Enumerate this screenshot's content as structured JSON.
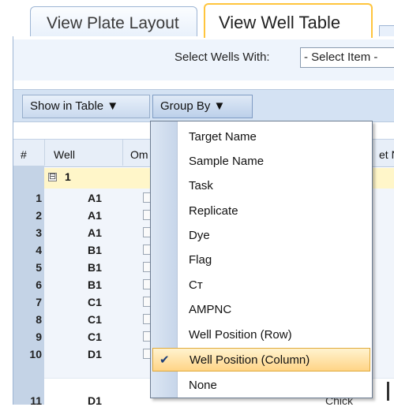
{
  "tabs": [
    {
      "label": "View Plate Layout",
      "active": false
    },
    {
      "label": "View Well Table",
      "active": true
    }
  ],
  "filter": {
    "label": "Select Wells With:",
    "select_value": "- Select Item -"
  },
  "toolbar": {
    "show_in_table": "Show in Table ▼",
    "group_by": "Group By ▼"
  },
  "table": {
    "headers": {
      "num": "#",
      "well": "Well",
      "omit": "Om",
      "target": "et N"
    },
    "group_label": "1",
    "group_toggle": "⊟",
    "rows": [
      {
        "num": "1",
        "well": "A1"
      },
      {
        "num": "2",
        "well": "A1"
      },
      {
        "num": "3",
        "well": "A1"
      },
      {
        "num": "4",
        "well": "B1"
      },
      {
        "num": "5",
        "well": "B1"
      },
      {
        "num": "6",
        "well": "B1"
      },
      {
        "num": "7",
        "well": "C1"
      },
      {
        "num": "8",
        "well": "C1"
      },
      {
        "num": "9",
        "well": "C1"
      },
      {
        "num": "10",
        "well": "D1"
      },
      {
        "num": "11",
        "well": "D1"
      }
    ],
    "cutoff_text": "Chick"
  },
  "group_by_menu": {
    "items": [
      {
        "label": "Target Name",
        "checked": false
      },
      {
        "label": "Sample Name",
        "checked": false
      },
      {
        "label": "Task",
        "checked": false
      },
      {
        "label": "Replicate",
        "checked": false
      },
      {
        "label": "Dye",
        "checked": false
      },
      {
        "label": "Flag",
        "checked": false
      },
      {
        "label": "Cт",
        "checked": false
      },
      {
        "label": "AMPNC",
        "checked": false
      },
      {
        "label": "Well Position (Row)",
        "checked": false
      },
      {
        "label": "Well Position (Column)",
        "checked": true
      },
      {
        "label": "None",
        "checked": false
      }
    ],
    "check_glyph": "✔"
  },
  "colors": {
    "active_tab_border": "#ffc53d",
    "selected_item": "#ffd486",
    "num_column": "#c4d3e6",
    "group_row": "#fff6c9"
  }
}
